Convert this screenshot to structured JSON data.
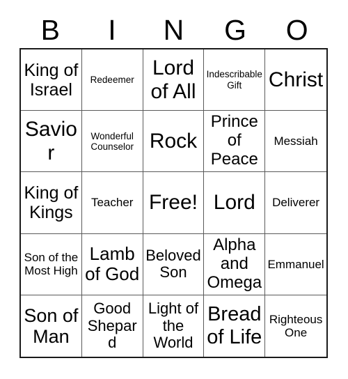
{
  "card": {
    "title_letters": [
      "B",
      "I",
      "N",
      "G",
      "O"
    ],
    "columns": 5,
    "rows": 5,
    "border_color": "#1a1a1a",
    "grid_line_color": "#5a5a5a",
    "background_color": "#ffffff",
    "text_color": "#000000"
  },
  "cells": [
    {
      "text": "King of Israel",
      "size": "lg"
    },
    {
      "text": "Redeemer",
      "size": "xs"
    },
    {
      "text": "Lord of All",
      "size": "xl"
    },
    {
      "text": "Indescribable Gift",
      "size": "xs"
    },
    {
      "text": "Christ",
      "size": "xl"
    },
    {
      "text": "Savior",
      "size": "xl"
    },
    {
      "text": "Wonderful Counselor",
      "size": "xs"
    },
    {
      "text": "Rock",
      "size": "xl"
    },
    {
      "text": "Prince of Peace",
      "size": "lg"
    },
    {
      "text": "Messiah",
      "size": "sm"
    },
    {
      "text": "King of Kings",
      "size": "lg"
    },
    {
      "text": "Teacher",
      "size": "sm"
    },
    {
      "text": "Free!",
      "size": "xl"
    },
    {
      "text": "Lord",
      "size": "xl"
    },
    {
      "text": "Deliverer",
      "size": "sm"
    },
    {
      "text": "Son of the Most High",
      "size": "sm"
    },
    {
      "text": "Lamb of God",
      "size": "lg"
    },
    {
      "text": "Beloved Son",
      "size": "md"
    },
    {
      "text": "Alpha and Omega",
      "size": "lg"
    },
    {
      "text": "Emmanuel",
      "size": "sm"
    },
    {
      "text": "Son of Man",
      "size": "xl"
    },
    {
      "text": "Good Shepard",
      "size": "md"
    },
    {
      "text": "Light of the World",
      "size": "md"
    },
    {
      "text": "Bread of Life",
      "size": "xl"
    },
    {
      "text": "Righteous One",
      "size": "sm"
    }
  ]
}
